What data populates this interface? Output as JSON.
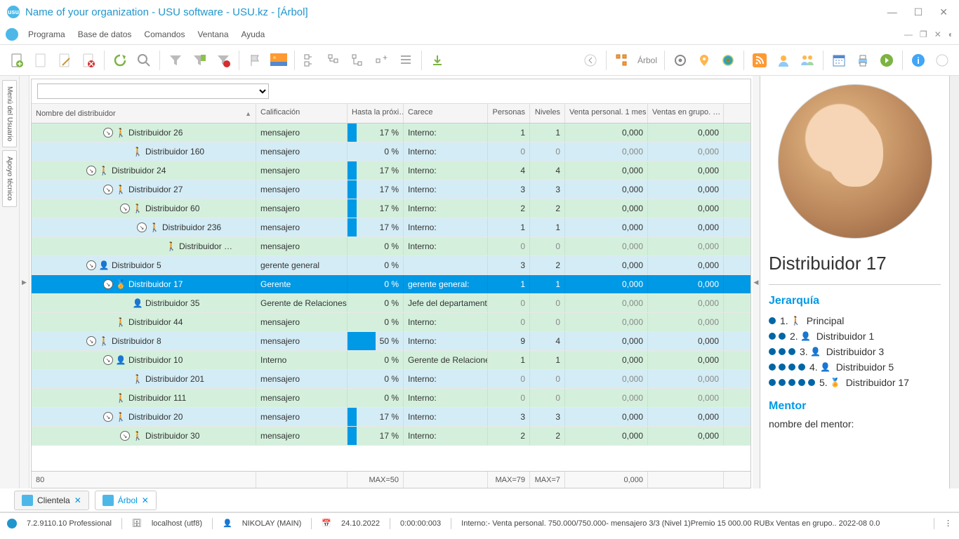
{
  "window": {
    "title": "Name of your organization - USU software - USU.kz - [Árbol]"
  },
  "menu": [
    "Programa",
    "Base de datos",
    "Comandos",
    "Ventana",
    "Ayuda"
  ],
  "toolbar": {
    "arbol": "Árbol"
  },
  "columns": {
    "name": "Nombre del distribuidor",
    "calif": "Calificación",
    "hasta": "Hasta la próxi…",
    "carece": "Carece",
    "pers": "Personas",
    "niv": "Niveles",
    "venta": "Venta personal. 1 mes",
    "grupo": "Ventas en grupo. …"
  },
  "rows": [
    {
      "indent": 4,
      "exp": true,
      "icon": "walk",
      "name": "Distribuidor 26",
      "calif": "mensajero",
      "pct": "17 %",
      "bar": 17,
      "carece": "Interno:",
      "p": "1",
      "n": "1",
      "v": "0,000",
      "g": "0,000",
      "cls": "green"
    },
    {
      "indent": 5,
      "exp": false,
      "icon": "walk",
      "name": "Distribuidor 160",
      "calif": "mensajero",
      "pct": "0 %",
      "bar": 0,
      "carece": "Interno:",
      "p": "0",
      "n": "0",
      "v": "0,000",
      "g": "0,000",
      "cls": "blue",
      "gray": true
    },
    {
      "indent": 3,
      "exp": true,
      "icon": "walk",
      "name": "Distribuidor 24",
      "calif": "mensajero",
      "pct": "17 %",
      "bar": 17,
      "carece": "Interno:",
      "p": "4",
      "n": "4",
      "v": "0,000",
      "g": "0,000",
      "cls": "green"
    },
    {
      "indent": 4,
      "exp": true,
      "icon": "walk",
      "name": "Distribuidor 27",
      "calif": "mensajero",
      "pct": "17 %",
      "bar": 17,
      "carece": "Interno:",
      "p": "3",
      "n": "3",
      "v": "0,000",
      "g": "0,000",
      "cls": "blue"
    },
    {
      "indent": 5,
      "exp": true,
      "icon": "walk",
      "name": "Distribuidor 60",
      "calif": "mensajero",
      "pct": "17 %",
      "bar": 17,
      "carece": "Interno:",
      "p": "2",
      "n": "2",
      "v": "0,000",
      "g": "0,000",
      "cls": "green"
    },
    {
      "indent": 6,
      "exp": true,
      "icon": "walk",
      "name": "Distribuidor 236",
      "calif": "mensajero",
      "pct": "17 %",
      "bar": 17,
      "carece": "Interno:",
      "p": "1",
      "n": "1",
      "v": "0,000",
      "g": "0,000",
      "cls": "blue"
    },
    {
      "indent": 7,
      "exp": false,
      "icon": "walk",
      "name": "Distribuidor …",
      "calif": "mensajero",
      "pct": "0 %",
      "bar": 0,
      "carece": "Interno:",
      "p": "0",
      "n": "0",
      "v": "0,000",
      "g": "0,000",
      "cls": "green",
      "gray": true
    },
    {
      "indent": 3,
      "exp": true,
      "icon": "mgr",
      "name": "Distribuidor 5",
      "calif": "gerente general",
      "pct": "0 %",
      "bar": 0,
      "carece": "",
      "p": "3",
      "n": "2",
      "v": "0,000",
      "g": "0,000",
      "cls": "blue"
    },
    {
      "indent": 4,
      "exp": true,
      "icon": "star",
      "name": "Distribuidor 17",
      "calif": "Gerente",
      "pct": "0 %",
      "bar": 0,
      "carece": "gerente general:",
      "p": "1",
      "n": "1",
      "v": "0,000",
      "g": "0,000",
      "cls": "sel"
    },
    {
      "indent": 5,
      "exp": false,
      "icon": "mgr",
      "name": "Distribuidor 35",
      "calif": "Gerente de Relaciones …",
      "pct": "0 %",
      "bar": 0,
      "carece": "Jefe del departamento:",
      "p": "0",
      "n": "0",
      "v": "0,000",
      "g": "0,000",
      "cls": "green",
      "gray": true
    },
    {
      "indent": 4,
      "exp": false,
      "icon": "walk",
      "name": "Distribuidor 44",
      "calif": "mensajero",
      "pct": "0 %",
      "bar": 0,
      "carece": "Interno:",
      "p": "0",
      "n": "0",
      "v": "0,000",
      "g": "0,000",
      "cls": "green",
      "gray": true
    },
    {
      "indent": 3,
      "exp": true,
      "icon": "walk",
      "name": "Distribuidor 8",
      "calif": "mensajero",
      "pct": "50 %",
      "bar": 50,
      "carece": "Interno:",
      "p": "9",
      "n": "4",
      "v": "0,000",
      "g": "0,000",
      "cls": "blue"
    },
    {
      "indent": 4,
      "exp": true,
      "icon": "mgr",
      "name": "Distribuidor 10",
      "calif": "Interno",
      "pct": "0 %",
      "bar": 0,
      "carece": "Gerente de Relacione…",
      "p": "1",
      "n": "1",
      "v": "0,000",
      "g": "0,000",
      "cls": "green"
    },
    {
      "indent": 5,
      "exp": false,
      "icon": "walk",
      "name": "Distribuidor 201",
      "calif": "mensajero",
      "pct": "0 %",
      "bar": 0,
      "carece": "Interno:",
      "p": "0",
      "n": "0",
      "v": "0,000",
      "g": "0,000",
      "cls": "blue",
      "gray": true
    },
    {
      "indent": 4,
      "exp": false,
      "icon": "walk",
      "name": "Distribuidor 111",
      "calif": "mensajero",
      "pct": "0 %",
      "bar": 0,
      "carece": "Interno:",
      "p": "0",
      "n": "0",
      "v": "0,000",
      "g": "0,000",
      "cls": "green",
      "gray": true
    },
    {
      "indent": 4,
      "exp": true,
      "icon": "walk",
      "name": "Distribuidor 20",
      "calif": "mensajero",
      "pct": "17 %",
      "bar": 17,
      "carece": "Interno:",
      "p": "3",
      "n": "3",
      "v": "0,000",
      "g": "0,000",
      "cls": "blue"
    },
    {
      "indent": 5,
      "exp": true,
      "icon": "walk",
      "name": "Distribuidor 30",
      "calif": "mensajero",
      "pct": "17 %",
      "bar": 17,
      "carece": "Interno:",
      "p": "2",
      "n": "2",
      "v": "0,000",
      "g": "0,000",
      "cls": "green"
    }
  ],
  "footer": {
    "count": "80",
    "max_hasta": "MAX=50",
    "max_pers": "MAX=79",
    "max_niv": "MAX=7",
    "venta": "0,000"
  },
  "sidepanel": {
    "title": "Distribuidor 17",
    "sect_hier": "Jerarquía",
    "hierarchy": [
      {
        "dots": 1,
        "num": "1.",
        "icon": "walk",
        "label": "Principal"
      },
      {
        "dots": 2,
        "num": "2.",
        "icon": "mgr",
        "label": "Distribuidor 1"
      },
      {
        "dots": 3,
        "num": "3.",
        "icon": "mgr",
        "label": "Distribuidor 3"
      },
      {
        "dots": 4,
        "num": "4.",
        "icon": "mgr",
        "label": "Distribuidor 5"
      },
      {
        "dots": 5,
        "num": "5.",
        "icon": "star",
        "label": "Distribuidor 17"
      }
    ],
    "sect_mentor": "Mentor",
    "mentor_name": "nombre del mentor:"
  },
  "leftrail": {
    "menu": "Menú del Usuario",
    "apoyo": "Apoyo técnico"
  },
  "tabs": [
    {
      "label": "Clientela",
      "active": false
    },
    {
      "label": "Árbol",
      "active": true
    }
  ],
  "status": {
    "version": "7.2.9110.10 Professional",
    "db": "localhost (utf8)",
    "user": "NIKOLAY (MAIN)",
    "date": "24.10.2022",
    "time": "0:00:00:003",
    "long": "Interno:- Venta personal. 750.000/750.000- mensajero 3/3 (Nivel 1)Premio 15 000.00 RUBx   Ventas en grupo..  2022-08 0.0"
  }
}
